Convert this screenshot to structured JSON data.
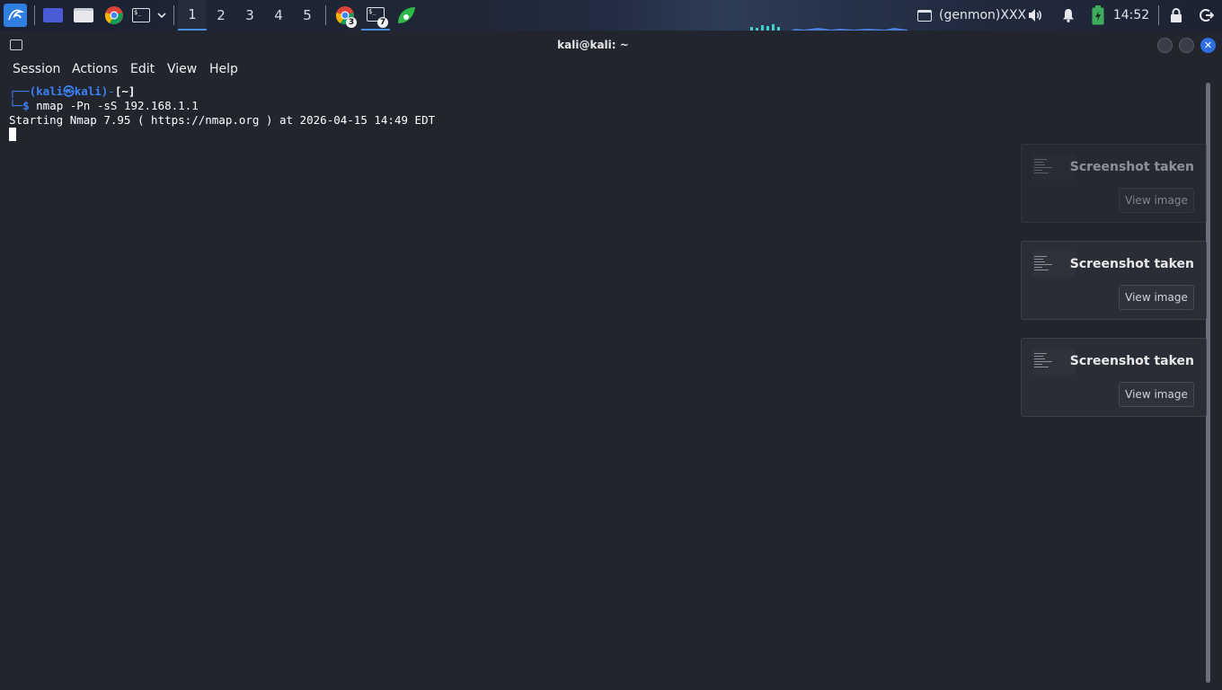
{
  "panel": {
    "workspaces": [
      "1",
      "2",
      "3",
      "4",
      "5"
    ],
    "active_workspace": "1",
    "chrome_badge": "3",
    "terminal_badge": "7",
    "genmon_text": "(genmon)XXX",
    "clock": "14:52"
  },
  "window": {
    "title": "kali@kali: ~"
  },
  "menu": {
    "items": [
      "Session",
      "Actions",
      "Edit",
      "View",
      "Help"
    ]
  },
  "terminal": {
    "prompt_corner": "┌──",
    "prompt_user": "(kali㉿kali)",
    "prompt_dash": "-",
    "prompt_dir": "[~]",
    "prompt_end": "└─",
    "prompt_symbol": "$",
    "command": " nmap -Pn -sS 192.168.1.1",
    "output_line": "Starting Nmap 7.95 ( https://nmap.org ) at 2026-04-15 14:49 EDT"
  },
  "notifications": [
    {
      "title": "Screenshot taken",
      "button": "View image"
    },
    {
      "title": "Screenshot taken",
      "button": "View image"
    },
    {
      "title": "Screenshot taken",
      "button": "View image"
    }
  ],
  "colors": {
    "accent": "#3b82f6",
    "terminal_bg": "#23252e",
    "close_button": "#2f6fe0"
  }
}
